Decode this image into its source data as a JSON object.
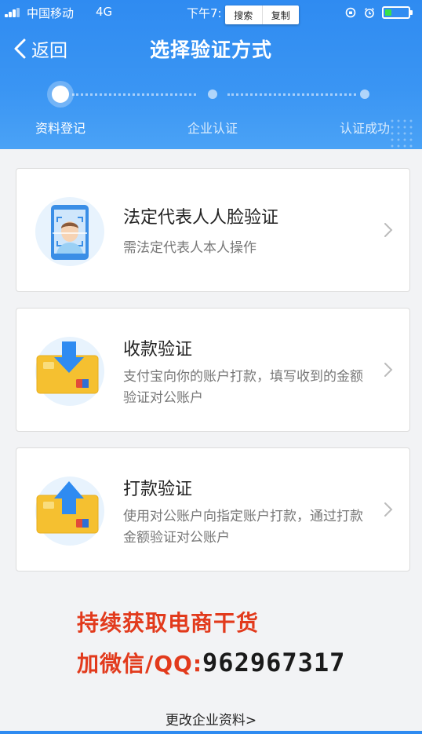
{
  "status_bar": {
    "carrier": "中国移动",
    "network": "4G",
    "time": "下午7:",
    "popup": {
      "search": "搜索",
      "copy": "复制"
    }
  },
  "nav": {
    "back_label": "返回",
    "title": "选择验证方式"
  },
  "steps": [
    {
      "label": "资料登记",
      "active": true
    },
    {
      "label": "企业认证",
      "active": false
    },
    {
      "label": "认证成功",
      "active": false
    }
  ],
  "options": [
    {
      "title": "法定代表人人脸验证",
      "desc": "需法定代表人本人操作",
      "icon": "face-scan-icon"
    },
    {
      "title": "收款验证",
      "desc": "支付宝向你的账户打款，填写收到的金额验证对公账户",
      "icon": "card-receive-icon"
    },
    {
      "title": "打款验证",
      "desc": "使用对公账户向指定账户打款，通过打款金额验证对公账户",
      "icon": "card-send-icon"
    }
  ],
  "promo": {
    "line1": "持续获取电商干货",
    "line2_prefix": "加微信/QQ:",
    "line2_number": "962967317"
  },
  "footer": {
    "link": "更改企业资料>"
  },
  "colors": {
    "header": "#2f8bf1",
    "promo": "#e23a1c",
    "card_icon_bg": "#e8f3fd",
    "card_yellow": "#f5c030",
    "arrow_blue": "#2f8bf1"
  }
}
